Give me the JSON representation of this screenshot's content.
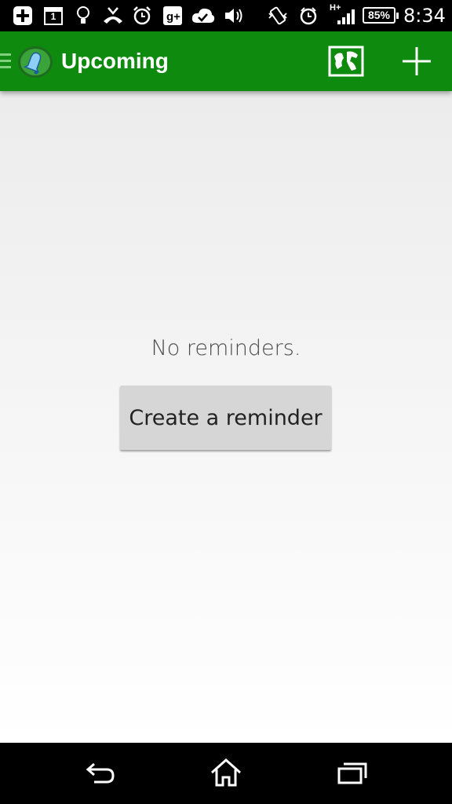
{
  "status_bar": {
    "battery_percent": "85%",
    "time": "8:34",
    "network": "H+",
    "calendar_day": "1",
    "icons": [
      "plus-box-icon",
      "calendar-icon",
      "lightbulb-icon",
      "missed-call-icon",
      "alarm-clock-icon",
      "google-plus-icon",
      "cloud-check-icon",
      "volume-icon",
      "vibrate-icon",
      "alarm-icon",
      "signal-icon",
      "battery-icon"
    ]
  },
  "app_bar": {
    "title": "Upcoming",
    "icons": [
      "menu-icon",
      "bell-logo-icon",
      "map-icon",
      "add-icon"
    ],
    "color": "#0e8a0e"
  },
  "content": {
    "empty_message": "No reminders.",
    "create_button_label": "Create a reminder"
  },
  "nav_bar": {
    "icons": [
      "back-icon",
      "home-icon",
      "recent-apps-icon"
    ]
  }
}
